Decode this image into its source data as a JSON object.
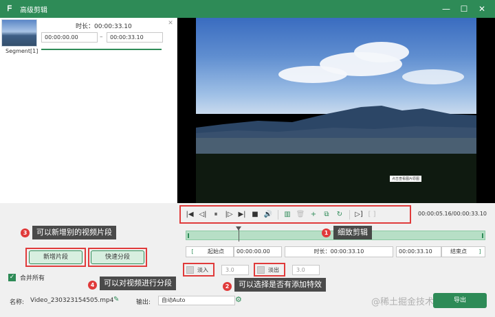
{
  "window": {
    "title": "高级剪辑",
    "logo_glyph": "ᖴ",
    "min_glyph": "—",
    "max_glyph": "☐",
    "close_glyph": "✕"
  },
  "segment": {
    "label": "Segment[1]",
    "duration": "时长：00:00:33.10",
    "start": "00:00:00.00",
    "end": "00:00:33.10",
    "dash": "–",
    "close_glyph": "✕"
  },
  "preview": {
    "tag": "点击查看图片原图"
  },
  "controls": {
    "icons": [
      "|◀",
      "◁|",
      "⏸",
      "|▷",
      "▶|",
      "■",
      "🔊",
      "▥",
      "🗑",
      "+",
      "⧉",
      "↻",
      "▷]",
      "[ ]"
    ],
    "time_readout": "00:00:05.16/00:00:33.10"
  },
  "timeline": {
    "start_label": "起始点",
    "start_value": "00:00:00.00",
    "duration_label": "时长：",
    "duration_value": "00:00:33.10",
    "end_value": "00:00:33.10",
    "end_label": "结束点",
    "bracket_left": "[",
    "bracket_right": "]"
  },
  "fx": {
    "fade_in": "淡入",
    "fade_in_value": "3.0",
    "fade_out": "淡出",
    "fade_out_value": "3.0"
  },
  "buttons": {
    "new_segment": "新增片段",
    "quick_split": "快速分段",
    "export": "导出"
  },
  "merge": {
    "label": "合并所有",
    "check_glyph": "✓"
  },
  "bottom": {
    "name_label": "名称:",
    "name_value": "Video_230323154505.mp4",
    "output_label": "输出:",
    "output_value": "自动Auto",
    "watermark": "@稀土掘金技术社区"
  },
  "annotations": [
    {
      "num": "1",
      "text": "细致剪辑"
    },
    {
      "num": "2",
      "text": "可以选择是否有添加特效"
    },
    {
      "num": "3",
      "text": "可以新增别的视频片段"
    },
    {
      "num": "4",
      "text": "可以对视频进行分段"
    }
  ],
  "colors": {
    "accent": "#2e8b57",
    "highlight": "#e03a3a"
  }
}
